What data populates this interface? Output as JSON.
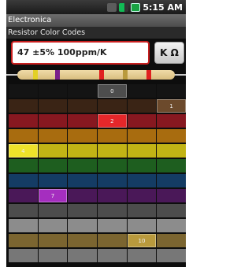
{
  "status_bar": {
    "time": "5:15 AM"
  },
  "app": {
    "title": "Electronica",
    "subtitle": "Resistor Color Codes"
  },
  "input": {
    "value": "47 ±5% 100ppm/K"
  },
  "unit_button": {
    "label": "K Ω"
  },
  "resistor_bands": [
    {
      "color": "#e3d026"
    },
    {
      "color": "#7a1e8a"
    },
    {
      "color": "#e02020"
    },
    {
      "color": "#b99a3d"
    },
    {
      "color": "#e02020"
    }
  ],
  "colors": {
    "black": "#141414",
    "brown": "#3a2415",
    "red": "#871820",
    "orange": "#a86c0f",
    "yellow": "#c2b415",
    "green": "#1e5e1f",
    "blue": "#143c64",
    "violet": "#4a1858",
    "gray": "#4c4c4c",
    "white": "#8c8c8c",
    "gold": "#7b6530",
    "silver": "#777777"
  },
  "grid_rows": [
    {
      "color": "#141414",
      "cells": [
        "",
        "",
        "",
        "",
        "",
        ""
      ],
      "selected": [
        3,
        null
      ],
      "sel_label": "0",
      "sel_color": "#4d4d4d"
    },
    {
      "color": "#3a2415",
      "cells": [
        "",
        "",
        "",
        "",
        "",
        ""
      ],
      "selected": [
        5,
        null
      ],
      "sel_label": "1",
      "sel_color": "#6c4a2c"
    },
    {
      "color": "#871820",
      "cells": [
        "",
        "",
        "",
        "",
        "",
        ""
      ],
      "selected": [
        3,
        null
      ],
      "sel_label": "2",
      "sel_color": "#e6272a"
    },
    {
      "color": "#a86c0f",
      "cells": [
        "",
        "",
        "",
        "",
        "",
        ""
      ]
    },
    {
      "color": "#c2b415",
      "cells": [
        "",
        "",
        "",
        "",
        "",
        ""
      ],
      "selected": [
        0,
        null
      ],
      "sel_label": "4",
      "sel_color": "#eee22a"
    },
    {
      "color": "#1e5e1f",
      "cells": [
        "",
        "",
        "",
        "",
        "",
        ""
      ]
    },
    {
      "color": "#143c64",
      "cells": [
        "",
        "",
        "",
        "",
        "",
        ""
      ]
    },
    {
      "color": "#4a1858",
      "cells": [
        "",
        "",
        "",
        "",
        "",
        ""
      ],
      "selected": [
        1,
        null
      ],
      "sel_label": "7",
      "sel_color": "#a52ebf"
    },
    {
      "color": "#4c4c4c",
      "cells": [
        "",
        "",
        "",
        "",
        "",
        ""
      ]
    },
    {
      "color": "#8c8c8c",
      "cells": [
        "",
        "",
        "",
        "",
        "",
        ""
      ]
    },
    {
      "color": "#7b6530",
      "cells": [
        "",
        "",
        "",
        "",
        "",
        ""
      ],
      "selected": [
        4,
        null
      ],
      "sel_label": "10",
      "sel_color": "#b99a3d"
    },
    {
      "color": "#777777",
      "cells": [
        "",
        "",
        "",
        "",
        "",
        ""
      ]
    }
  ]
}
